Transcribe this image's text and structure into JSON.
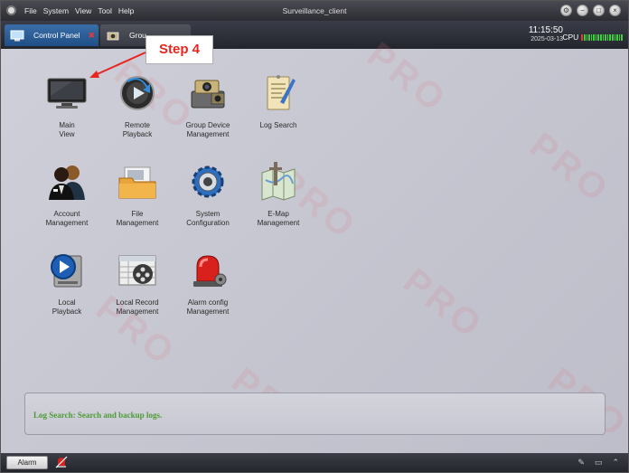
{
  "window": {
    "title": "Surveillance_client",
    "menu": [
      "File",
      "System",
      "View",
      "Tool",
      "Help"
    ]
  },
  "tabs": [
    {
      "label": "Control Panel",
      "active": true
    },
    {
      "label": "Grou",
      "active": false
    }
  ],
  "status": {
    "time": "11:15:50",
    "date": "2025-03-13",
    "cpu_label": "CPU"
  },
  "grid": [
    {
      "label": [
        "Main",
        "View"
      ],
      "icon": "monitor-icon"
    },
    {
      "label": [
        "Remote",
        "Playback"
      ],
      "icon": "remote-playback-icon"
    },
    {
      "label": [
        "Group Device",
        "Management"
      ],
      "icon": "group-device-icon"
    },
    {
      "label": [
        "Log Search",
        ""
      ],
      "icon": "log-search-icon"
    },
    {
      "label": [
        "Account",
        "Management"
      ],
      "icon": "account-icon"
    },
    {
      "label": [
        "File",
        "Management"
      ],
      "icon": "folder-icon"
    },
    {
      "label": [
        "System",
        "Configuration"
      ],
      "icon": "gear-icon"
    },
    {
      "label": [
        "E-Map",
        "Management"
      ],
      "icon": "map-icon"
    },
    {
      "label": [
        "Local",
        "Playback"
      ],
      "icon": "local-playback-icon"
    },
    {
      "label": [
        "Local Record",
        "Management"
      ],
      "icon": "film-icon"
    },
    {
      "label": [
        "Alarm config",
        "Management"
      ],
      "icon": "alarm-light-icon"
    }
  ],
  "info_panel": {
    "message": "Log Search: Search and backup logs."
  },
  "bottombar": {
    "alarm_label": "Alarm"
  },
  "annotation": {
    "label": "Step 4"
  },
  "colors": {
    "accent_tab": "#2d5f99",
    "status_text": "#4d9b34",
    "annotation": "#e8251f"
  }
}
